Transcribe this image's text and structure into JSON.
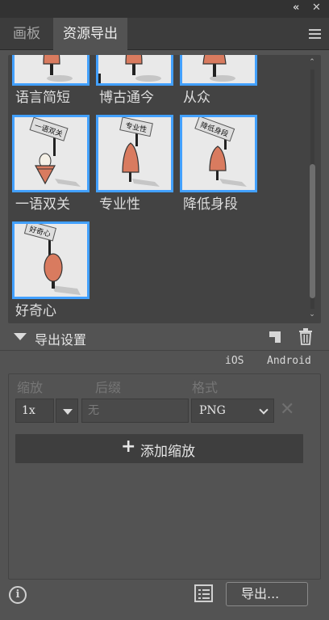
{
  "titlebar": {
    "collapse": "«",
    "close": "✕"
  },
  "tabs": [
    {
      "label": "画板",
      "active": false
    },
    {
      "label": "资源导出",
      "active": true
    }
  ],
  "assets": [
    {
      "label": "语言简短",
      "sign": ""
    },
    {
      "label": "博古通今",
      "sign": ""
    },
    {
      "label": "从众",
      "sign": ""
    },
    {
      "label": "一语双关",
      "sign": "一语双关"
    },
    {
      "label": "专业性",
      "sign": "专业性"
    },
    {
      "label": "降低身段",
      "sign": "降低身段"
    },
    {
      "label": "好奇心",
      "sign": "好奇心"
    }
  ],
  "export_settings": {
    "title": "导出设置",
    "platforms": [
      "iOS",
      "Android"
    ],
    "columns": {
      "scale": "缩放",
      "suffix": "后缀",
      "format": "格式"
    },
    "row": {
      "scale": "1x",
      "suffix_placeholder": "无",
      "format": "PNG"
    },
    "add_scale": "添加缩放"
  },
  "footer": {
    "export": "导出..."
  },
  "colors": {
    "accent": "#42a0ff",
    "panel": "#535353",
    "cone": "#d97b5f"
  }
}
